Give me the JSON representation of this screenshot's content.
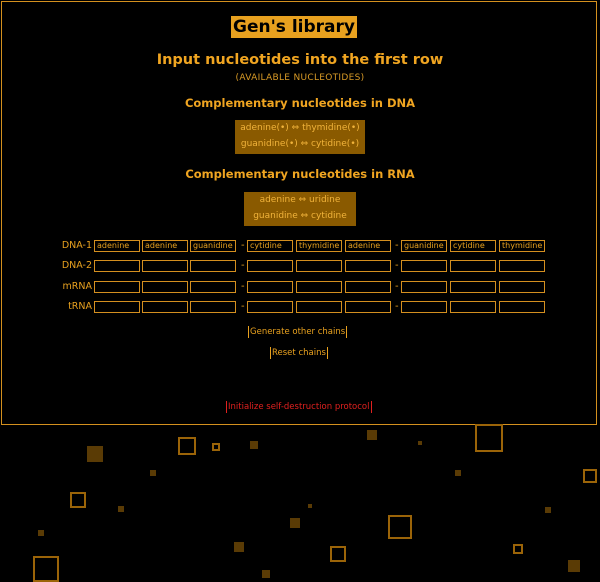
{
  "app": {
    "title": "Gen's library",
    "instruction": "Input nucleotides into the first row",
    "available": "(AVAILABLE NUCLEOTIDES)"
  },
  "dna_section": {
    "heading": "Complementary nucleotides in DNA",
    "pairs": [
      "adenine(•) ⇔ thymidine(•)",
      "guanidine(•) ⇔ cytidine(•)"
    ]
  },
  "rna_section": {
    "heading": "Complementary nucleotides in RNA",
    "pairs": [
      "adenine ⇔ uridine",
      "guanidine ⇔ cytidine"
    ]
  },
  "chains": {
    "rows": [
      {
        "label": "DNA-1",
        "cells": [
          "adenine",
          "adenine",
          "guanidine",
          "cytidine",
          "thymidine",
          "adenine",
          "guanidine",
          "cytidine",
          "thymidine"
        ]
      },
      {
        "label": "DNA-2",
        "cells": [
          "",
          "",
          "",
          "",
          "",
          "",
          "",
          "",
          ""
        ]
      },
      {
        "label": "mRNA",
        "cells": [
          "",
          "",
          "",
          "",
          "",
          "",
          "",
          "",
          ""
        ]
      },
      {
        "label": "tRNA",
        "cells": [
          "",
          "",
          "",
          "",
          "",
          "",
          "",
          "",
          ""
        ]
      }
    ],
    "separator": "-"
  },
  "buttons": {
    "generate": "Generate other chains",
    "reset": "Reset chains",
    "self_destruct": "Initialize self-destruction protocol"
  },
  "colors": {
    "accent": "#e8a11f",
    "box_bg": "#8a5a00",
    "danger": "#e0211f",
    "background": "#000000"
  }
}
